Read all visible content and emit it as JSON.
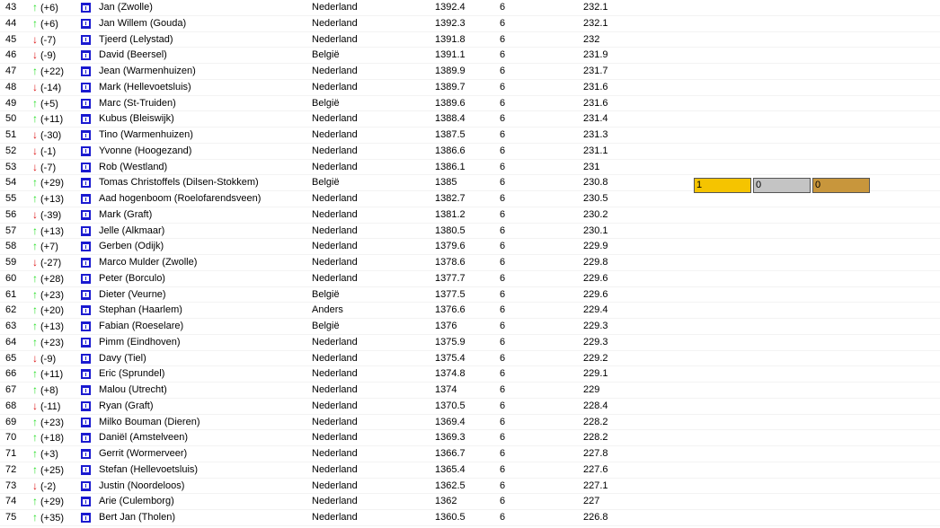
{
  "rows": [
    {
      "rank": "43",
      "dir": "up",
      "change": "(+6)",
      "name": "Jan (Zwolle)",
      "country": "Nederland",
      "score": "1392.4",
      "games": "6",
      "avg": "232.1"
    },
    {
      "rank": "44",
      "dir": "up",
      "change": "(+6)",
      "name": "Jan Willem (Gouda)",
      "country": "Nederland",
      "score": "1392.3",
      "games": "6",
      "avg": "232.1"
    },
    {
      "rank": "45",
      "dir": "down",
      "change": "(-7)",
      "name": "Tjeerd (Lelystad)",
      "country": "Nederland",
      "score": "1391.8",
      "games": "6",
      "avg": "232"
    },
    {
      "rank": "46",
      "dir": "down",
      "change": "(-9)",
      "name": "David (Beersel)",
      "country": "België",
      "score": "1391.1",
      "games": "6",
      "avg": "231.9"
    },
    {
      "rank": "47",
      "dir": "up",
      "change": "(+22)",
      "name": "Jean (Warmenhuizen)",
      "country": "Nederland",
      "score": "1389.9",
      "games": "6",
      "avg": "231.7"
    },
    {
      "rank": "48",
      "dir": "down",
      "change": "(-14)",
      "name": "Mark (Hellevoetsluis)",
      "country": "Nederland",
      "score": "1389.7",
      "games": "6",
      "avg": "231.6"
    },
    {
      "rank": "49",
      "dir": "up",
      "change": "(+5)",
      "name": "Marc (St-Truiden)",
      "country": "België",
      "score": "1389.6",
      "games": "6",
      "avg": "231.6"
    },
    {
      "rank": "50",
      "dir": "up",
      "change": "(+11)",
      "name": "Kubus (Bleiswijk)",
      "country": "Nederland",
      "score": "1388.4",
      "games": "6",
      "avg": "231.4"
    },
    {
      "rank": "51",
      "dir": "down",
      "change": "(-30)",
      "name": "Tino (Warmenhuizen)",
      "country": "Nederland",
      "score": "1387.5",
      "games": "6",
      "avg": "231.3"
    },
    {
      "rank": "52",
      "dir": "down",
      "change": "(-1)",
      "name": "Yvonne (Hoogezand)",
      "country": "Nederland",
      "score": "1386.6",
      "games": "6",
      "avg": "231.1"
    },
    {
      "rank": "53",
      "dir": "down",
      "change": "(-7)",
      "name": "Rob (Westland)",
      "country": "Nederland",
      "score": "1386.1",
      "games": "6",
      "avg": "231"
    },
    {
      "rank": "54",
      "dir": "up",
      "change": "(+29)",
      "name": "Tomas Christoffels (Dilsen-Stokkem)",
      "country": "België",
      "score": "1385",
      "games": "6",
      "avg": "230.8"
    },
    {
      "rank": "55",
      "dir": "up",
      "change": "(+13)",
      "name": "Aad hogenboom (Roelofarendsveen)",
      "country": "Nederland",
      "score": "1382.7",
      "games": "6",
      "avg": "230.5"
    },
    {
      "rank": "56",
      "dir": "down",
      "change": "(-39)",
      "name": "Mark (Graft)",
      "country": "Nederland",
      "score": "1381.2",
      "games": "6",
      "avg": "230.2"
    },
    {
      "rank": "57",
      "dir": "up",
      "change": "(+13)",
      "name": "Jelle (Alkmaar)",
      "country": "Nederland",
      "score": "1380.5",
      "games": "6",
      "avg": "230.1"
    },
    {
      "rank": "58",
      "dir": "up",
      "change": "(+7)",
      "name": "Gerben (Odijk)",
      "country": "Nederland",
      "score": "1379.6",
      "games": "6",
      "avg": "229.9"
    },
    {
      "rank": "59",
      "dir": "down",
      "change": "(-27)",
      "name": "Marco Mulder (Zwolle)",
      "country": "Nederland",
      "score": "1378.6",
      "games": "6",
      "avg": "229.8"
    },
    {
      "rank": "60",
      "dir": "up",
      "change": "(+28)",
      "name": "Peter (Borculo)",
      "country": "Nederland",
      "score": "1377.7",
      "games": "6",
      "avg": "229.6"
    },
    {
      "rank": "61",
      "dir": "up",
      "change": "(+23)",
      "name": "Dieter (Veurne)",
      "country": "België",
      "score": "1377.5",
      "games": "6",
      "avg": "229.6"
    },
    {
      "rank": "62",
      "dir": "up",
      "change": "(+20)",
      "name": "Stephan (Haarlem)",
      "country": "Anders",
      "score": "1376.6",
      "games": "6",
      "avg": "229.4"
    },
    {
      "rank": "63",
      "dir": "up",
      "change": "(+13)",
      "name": "Fabian (Roeselare)",
      "country": "België",
      "score": "1376",
      "games": "6",
      "avg": "229.3"
    },
    {
      "rank": "64",
      "dir": "up",
      "change": "(+23)",
      "name": "Pimm (Eindhoven)",
      "country": "Nederland",
      "score": "1375.9",
      "games": "6",
      "avg": "229.3"
    },
    {
      "rank": "65",
      "dir": "down",
      "change": "(-9)",
      "name": "Davy (Tiel)",
      "country": "Nederland",
      "score": "1375.4",
      "games": "6",
      "avg": "229.2"
    },
    {
      "rank": "66",
      "dir": "up",
      "change": "(+11)",
      "name": "Eric (Sprundel)",
      "country": "Nederland",
      "score": "1374.8",
      "games": "6",
      "avg": "229.1"
    },
    {
      "rank": "67",
      "dir": "up",
      "change": "(+8)",
      "name": "Malou (Utrecht)",
      "country": "Nederland",
      "score": "1374",
      "games": "6",
      "avg": "229"
    },
    {
      "rank": "68",
      "dir": "down",
      "change": "(-11)",
      "name": "Ryan (Graft)",
      "country": "Nederland",
      "score": "1370.5",
      "games": "6",
      "avg": "228.4"
    },
    {
      "rank": "69",
      "dir": "up",
      "change": "(+23)",
      "name": "Milko Bouman (Dieren)",
      "country": "Nederland",
      "score": "1369.4",
      "games": "6",
      "avg": "228.2"
    },
    {
      "rank": "70",
      "dir": "up",
      "change": "(+18)",
      "name": "Daniël (Amstelveen)",
      "country": "Nederland",
      "score": "1369.3",
      "games": "6",
      "avg": "228.2"
    },
    {
      "rank": "71",
      "dir": "up",
      "change": "(+3)",
      "name": "Gerrit (Wormerveer)",
      "country": "Nederland",
      "score": "1366.7",
      "games": "6",
      "avg": "227.8"
    },
    {
      "rank": "72",
      "dir": "up",
      "change": "(+25)",
      "name": "Stefan (Hellevoetsluis)",
      "country": "Nederland",
      "score": "1365.4",
      "games": "6",
      "avg": "227.6"
    },
    {
      "rank": "73",
      "dir": "down",
      "change": "(-2)",
      "name": "Justin (Noordeloos)",
      "country": "Nederland",
      "score": "1362.5",
      "games": "6",
      "avg": "227.1"
    },
    {
      "rank": "74",
      "dir": "up",
      "change": "(+29)",
      "name": "Arie (Culemborg)",
      "country": "Nederland",
      "score": "1362",
      "games": "6",
      "avg": "227"
    },
    {
      "rank": "75",
      "dir": "up",
      "change": "(+35)",
      "name": "Bert Jan (Tholen)",
      "country": "Nederland",
      "score": "1360.5",
      "games": "6",
      "avg": "226.8"
    }
  ],
  "arrows": {
    "up": "↑",
    "down": "↓"
  },
  "medals": {
    "gold": "1",
    "silver": "0",
    "bronze": "0"
  },
  "colors": {
    "up": "#22dd22",
    "down": "#dd1111",
    "icon": "#1a1ad0",
    "gold": "#f5c400",
    "silver": "#c4c4c4",
    "bronze": "#c8963c"
  }
}
